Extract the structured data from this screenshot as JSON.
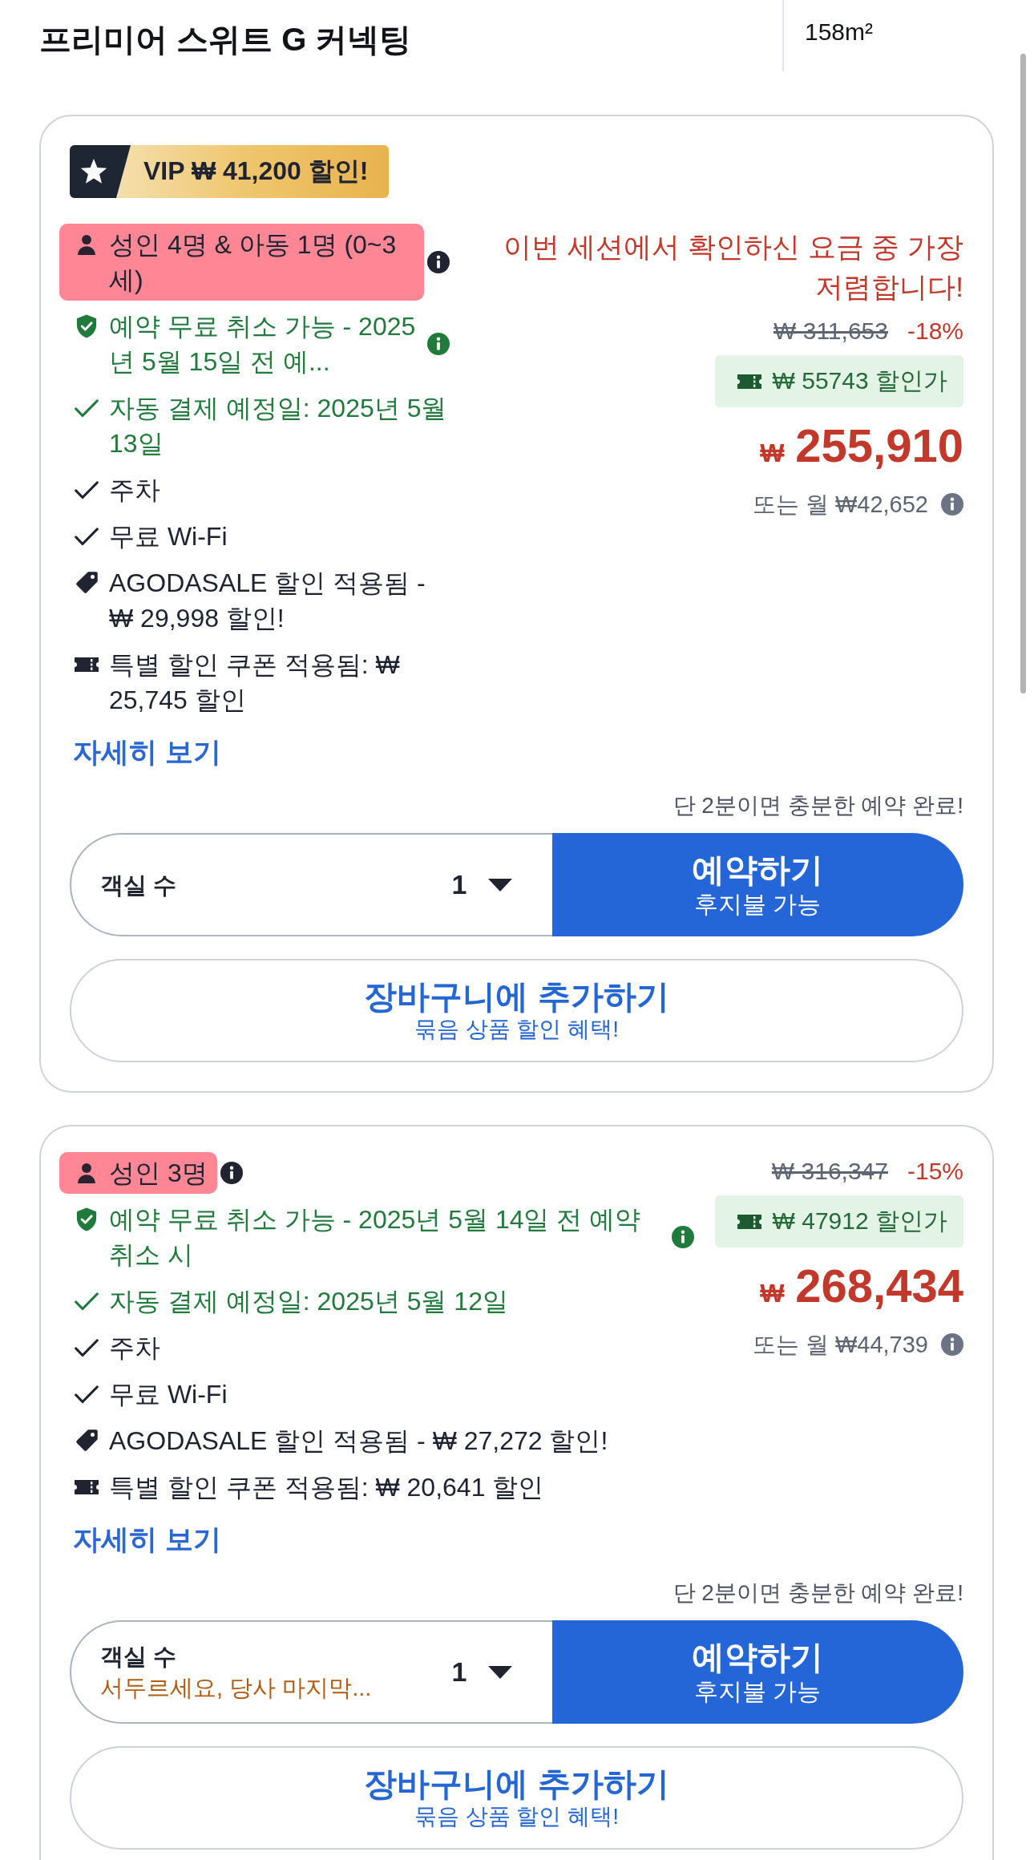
{
  "header": {
    "title": "프리미어 스위트 G 커넥팅",
    "room_size": "158m²"
  },
  "offers": [
    {
      "vip_badge": "VIP ₩ 41,200 할인!",
      "occupancy": {
        "text": "성인 4명 & 아동 1명 (0~3세)",
        "highlighted": true
      },
      "features": [
        {
          "kind": "cancellation",
          "text": "예약 무료 취소 가능 - 2025년 5월 15일 전 예..."
        },
        {
          "kind": "payment",
          "text": "자동 결제 예정일: 2025년 5월 13일"
        },
        {
          "kind": "amenity",
          "text": "주차"
        },
        {
          "kind": "amenity",
          "text": "무료 Wi-Fi"
        },
        {
          "kind": "promo",
          "text": "AGODASALE 할인 적용됨 - ₩ 29,998 할인!"
        },
        {
          "kind": "coupon",
          "text": "특별 할인 쿠폰 적용됨: ₩ 25,745 할인"
        }
      ],
      "price_note": "이번 세션에서 확인하신 요금 중 가장 저렴합니다!",
      "original_price": "₩ 311,653",
      "discount": "-18%",
      "coupon_price": "₩ 55743 할인가",
      "currency": "₩",
      "price": "255,910",
      "monthly": "또는 월 ₩42,652",
      "details_link": "자세히 보기",
      "booking_note": "단 2분이면 충분한 예약 완료!",
      "rooms": {
        "label": "객실 수",
        "value": "1"
      },
      "book_button": {
        "label": "예약하기",
        "sublabel": "후지불 가능"
      },
      "cart_button": {
        "label": "장바구니에 추가하기",
        "sublabel": "묶음 상품 할인 혜택!"
      }
    },
    {
      "occupancy": {
        "text": "성인 3명",
        "highlighted": true
      },
      "features": [
        {
          "kind": "cancellation",
          "text": "예약 무료 취소 가능 - 2025년 5월 14일 전 예약 취소 시"
        },
        {
          "kind": "payment",
          "text": "자동 결제 예정일: 2025년 5월 12일"
        },
        {
          "kind": "amenity",
          "text": "주차"
        },
        {
          "kind": "amenity",
          "text": "무료 Wi-Fi"
        },
        {
          "kind": "promo",
          "text": "AGODASALE 할인 적용됨 - ₩ 27,272 할인!"
        },
        {
          "kind": "coupon",
          "text": "특별 할인 쿠폰 적용됨: ₩ 20,641 할인"
        }
      ],
      "original_price": "₩ 316,347",
      "discount": "-15%",
      "coupon_price": "₩ 47912 할인가",
      "currency": "₩",
      "price": "268,434",
      "monthly": "또는 월 ₩44,739",
      "details_link": "자세히 보기",
      "booking_note": "단 2분이면 충분한 예약 완료!",
      "rooms": {
        "label": "객실 수",
        "warning": "서두르세요, 당사 마지막...",
        "value": "1"
      },
      "book_button": {
        "label": "예약하기",
        "sublabel": "후지불 가능"
      },
      "cart_button": {
        "label": "장바구니에 추가하기",
        "sublabel": "묶음 상품 할인 혜택!"
      }
    }
  ]
}
